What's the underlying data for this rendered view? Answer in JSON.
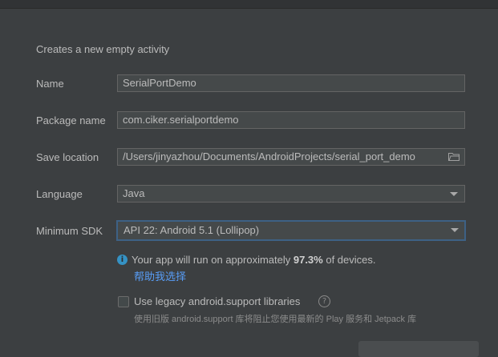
{
  "description": "Creates a new empty activity",
  "form": {
    "name": {
      "label": "Name",
      "value": "SerialPortDemo"
    },
    "package": {
      "label": "Package name",
      "value": "com.ciker.serialportdemo"
    },
    "save_location": {
      "label": "Save location",
      "value": "/Users/jinyazhou/Documents/AndroidProjects/serial_port_demo",
      "icon": "folder-icon"
    },
    "language": {
      "label": "Language",
      "value": "Java"
    },
    "min_sdk": {
      "label": "Minimum SDK",
      "value": "API 22: Android 5.1 (Lollipop)"
    }
  },
  "info": {
    "icon": "info-icon",
    "text_before": "Your app will run on approximately ",
    "percent": "97.3%",
    "text_after": " of devices.",
    "help_link": "帮助我选择"
  },
  "legacy": {
    "label": "Use legacy android.support libraries",
    "checked": false,
    "help_icon": "?",
    "note": "使用旧版 android.support 库将阻止您使用最新的 Play 服务和 Jetpack 库"
  },
  "colors": {
    "background": "#3c3f41",
    "field": "#45494a",
    "focus_border": "#3d6185",
    "link": "#589df6",
    "info": "#3592c4"
  }
}
